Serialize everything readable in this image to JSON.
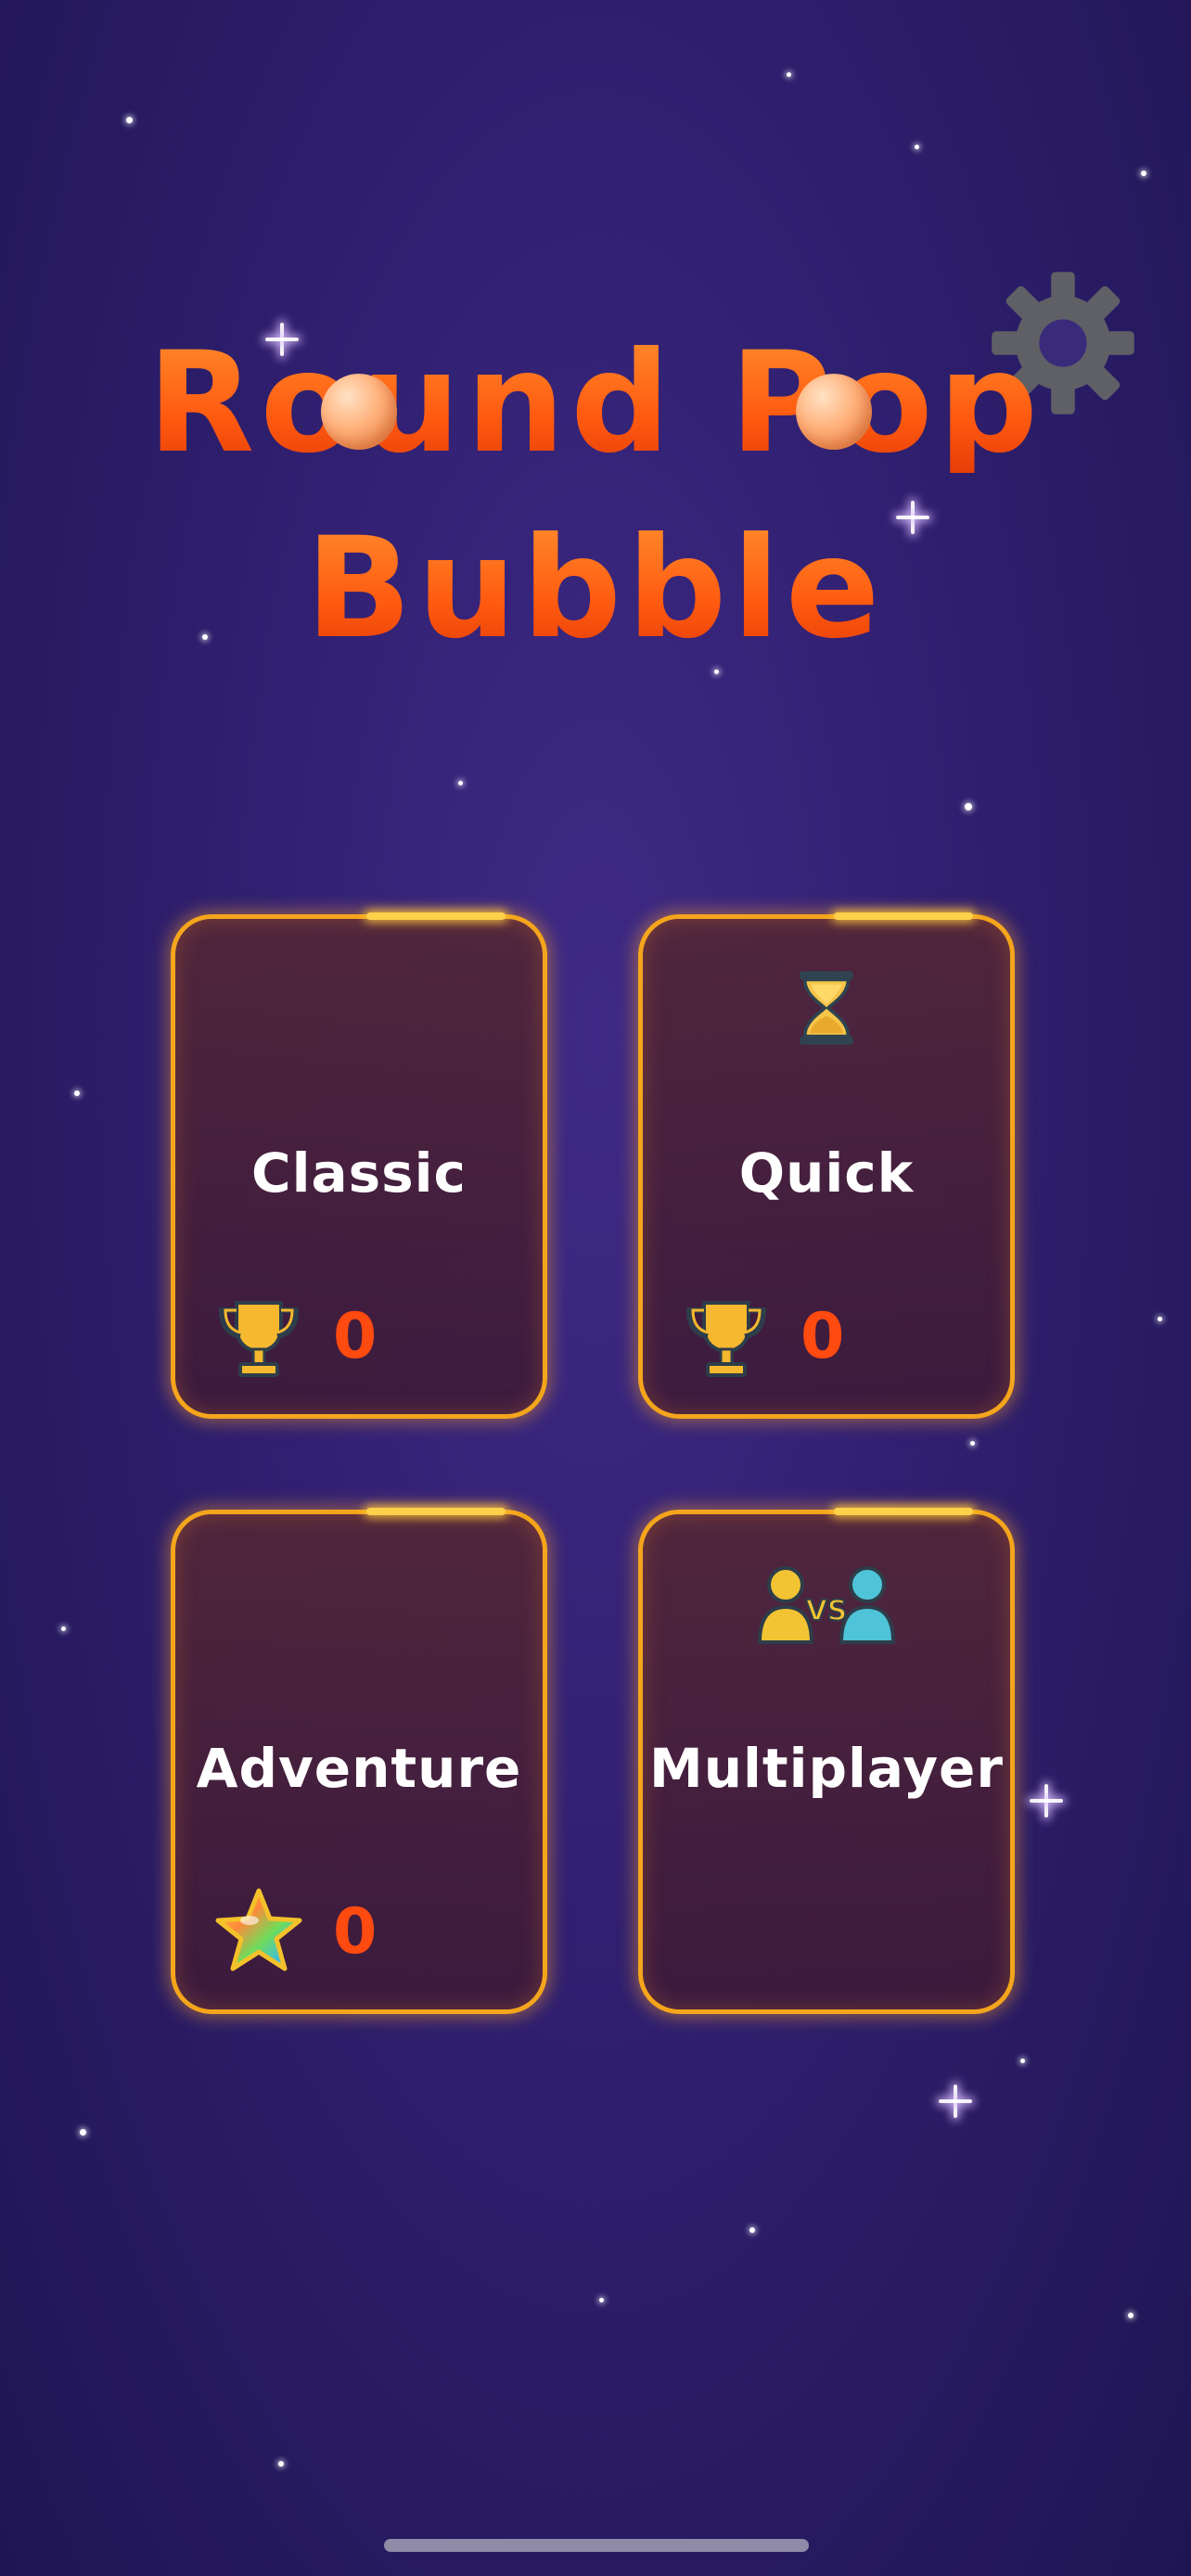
{
  "title": {
    "line1": "Round Pop",
    "line2": "Bubble"
  },
  "icons": {
    "settings": "gear-icon",
    "trophy": "trophy-icon",
    "hourglass": "hourglass-icon",
    "star": "star-icon",
    "versus": "versus-icon"
  },
  "colors": {
    "background": "#2f1f6f",
    "title": "#ff5a10",
    "card_border": "#f4a51c",
    "score": "#ff4a10",
    "gear": "#5f5f66"
  },
  "modes": [
    {
      "label": "Classic",
      "score": "0",
      "score_icon": "trophy-icon"
    },
    {
      "label": "Quick",
      "score": "0",
      "score_icon": "trophy-icon",
      "top_icon": "hourglass-icon"
    },
    {
      "label": "Adventure",
      "score": "0",
      "score_icon": "star-icon"
    },
    {
      "label": "Multiplayer",
      "top_icon": "versus-icon"
    }
  ]
}
